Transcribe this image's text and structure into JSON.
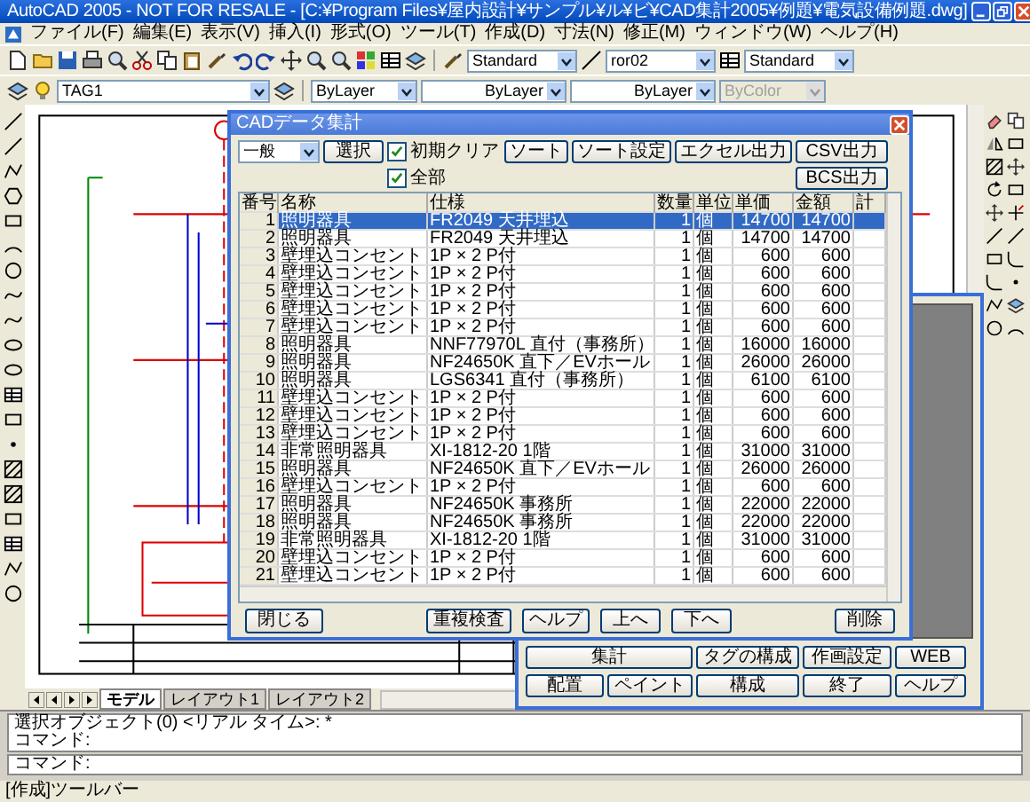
{
  "window": {
    "title": "AutoCAD 2005 - NOT FOR RESALE - [C:¥Program Files¥屋内設計¥サンプル¥ル¥ビ¥CAD集計2005¥例題¥電気設備例題.dwg]"
  },
  "menu": [
    "ファイル(F)",
    "編集(E)",
    "表示(V)",
    "挿入(I)",
    "形式(O)",
    "ツール(T)",
    "作成(D)",
    "寸法(N)",
    "修正(M)",
    "ウィンドウ(W)",
    "ヘルプ(H)"
  ],
  "styles_toolbar": {
    "text_style": "Standard",
    "dim_style": "ror02",
    "table_style": "Standard"
  },
  "layers_toolbar": {
    "layer": "TAG1",
    "color_control": "ByLayer",
    "linetype": "ByLayer",
    "lineweight": "ByLayer",
    "plot_style": {
      "value": "ByColor",
      "disabled": true
    }
  },
  "layout_tabs": [
    {
      "label": "モデル",
      "selected": true
    },
    {
      "label": "レイアウト1",
      "selected": false
    },
    {
      "label": "レイアウト2",
      "selected": false
    }
  ],
  "command_lines": [
    "選択オブジェクト(0) <リアル タイム>: *",
    "コマンド:",
    "コマンド:"
  ],
  "status_bar": "[作成]ツールバー",
  "cad_dialog": {
    "title": "CADデータ集計",
    "category": "一般",
    "select_button": "選択",
    "options": [
      {
        "label": "初期クリア",
        "checked": true
      },
      {
        "label": "全部",
        "checked": true
      }
    ],
    "buttons": [
      "ソート",
      "ソート設定",
      "エクセル出力",
      "CSV出力",
      "BCS出力"
    ],
    "table": {
      "columns": [
        "番号",
        "名称",
        "仕様",
        "数量",
        "単位",
        "単価",
        "金額",
        "計"
      ],
      "rows": [
        {
          "no": "1",
          "name": "照明器具",
          "spec": "FR2049 天井埋込",
          "qty": "1",
          "unit": "個",
          "price": "14700",
          "amount": "14700",
          "selected": true
        },
        {
          "no": "2",
          "name": "照明器具",
          "spec": "FR2049 天井埋込",
          "qty": "1",
          "unit": "個",
          "price": "14700",
          "amount": "14700",
          "selected": false
        },
        {
          "no": "3",
          "name": "壁埋込コンセント",
          "spec": "1P × 2 P付",
          "qty": "1",
          "unit": "個",
          "price": "600",
          "amount": "600",
          "selected": false
        },
        {
          "no": "4",
          "name": "壁埋込コンセント",
          "spec": "1P × 2 P付",
          "qty": "1",
          "unit": "個",
          "price": "600",
          "amount": "600",
          "selected": false
        },
        {
          "no": "5",
          "name": "壁埋込コンセント",
          "spec": "1P × 2 P付",
          "qty": "1",
          "unit": "個",
          "price": "600",
          "amount": "600",
          "selected": false
        },
        {
          "no": "6",
          "name": "壁埋込コンセント",
          "spec": "1P × 2 P付",
          "qty": "1",
          "unit": "個",
          "price": "600",
          "amount": "600",
          "selected": false
        },
        {
          "no": "7",
          "name": "壁埋込コンセント",
          "spec": "1P × 2 P付",
          "qty": "1",
          "unit": "個",
          "price": "600",
          "amount": "600",
          "selected": false
        },
        {
          "no": "8",
          "name": "照明器具",
          "spec": "NNF77970L 直付（事務所）",
          "qty": "1",
          "unit": "個",
          "price": "16000",
          "amount": "16000",
          "selected": false
        },
        {
          "no": "9",
          "name": "照明器具",
          "spec": "NF24650K 直下／EVホール",
          "qty": "1",
          "unit": "個",
          "price": "26000",
          "amount": "26000",
          "selected": false
        },
        {
          "no": "10",
          "name": "照明器具",
          "spec": "LGS6341 直付（事務所）",
          "qty": "1",
          "unit": "個",
          "price": "6100",
          "amount": "6100",
          "selected": false
        },
        {
          "no": "11",
          "name": "壁埋込コンセント",
          "spec": "1P × 2 P付",
          "qty": "1",
          "unit": "個",
          "price": "600",
          "amount": "600",
          "selected": false
        },
        {
          "no": "12",
          "name": "壁埋込コンセント",
          "spec": "1P × 2 P付",
          "qty": "1",
          "unit": "個",
          "price": "600",
          "amount": "600",
          "selected": false
        },
        {
          "no": "13",
          "name": "壁埋込コンセント",
          "spec": "1P × 2 P付",
          "qty": "1",
          "unit": "個",
          "price": "600",
          "amount": "600",
          "selected": false
        },
        {
          "no": "14",
          "name": "非常照明器具",
          "spec": "XI-1812-20 1階",
          "qty": "1",
          "unit": "個",
          "price": "31000",
          "amount": "31000",
          "selected": false
        },
        {
          "no": "15",
          "name": "照明器具",
          "spec": "NF24650K 直下／EVホール",
          "qty": "1",
          "unit": "個",
          "price": "26000",
          "amount": "26000",
          "selected": false
        },
        {
          "no": "16",
          "name": "壁埋込コンセント",
          "spec": "1P × 2 P付",
          "qty": "1",
          "unit": "個",
          "price": "600",
          "amount": "600",
          "selected": false
        },
        {
          "no": "17",
          "name": "照明器具",
          "spec": "NF24650K 事務所",
          "qty": "1",
          "unit": "個",
          "price": "22000",
          "amount": "22000",
          "selected": false
        },
        {
          "no": "18",
          "name": "照明器具",
          "spec": "NF24650K 事務所",
          "qty": "1",
          "unit": "個",
          "price": "22000",
          "amount": "22000",
          "selected": false
        },
        {
          "no": "19",
          "name": "非常照明器具",
          "spec": "XI-1812-20 1階",
          "qty": "1",
          "unit": "個",
          "price": "31000",
          "amount": "31000",
          "selected": false
        },
        {
          "no": "20",
          "name": "壁埋込コンセント",
          "spec": "1P × 2 P付",
          "qty": "1",
          "unit": "個",
          "price": "600",
          "amount": "600",
          "selected": false
        },
        {
          "no": "21",
          "name": "壁埋込コンセント",
          "spec": "1P × 2 P付",
          "qty": "1",
          "unit": "個",
          "price": "600",
          "amount": "600",
          "selected": false
        }
      ]
    },
    "footer_buttons": [
      "閉じる",
      "重複検査",
      "ヘルプ",
      "上へ",
      "下へ",
      "削除"
    ]
  },
  "tag_dialog": {
    "buttons": [
      "集計",
      "タグの構成",
      "作画設定",
      "WEB",
      "配置",
      "ペイント",
      "構成",
      "終了",
      "ヘルプ"
    ]
  }
}
